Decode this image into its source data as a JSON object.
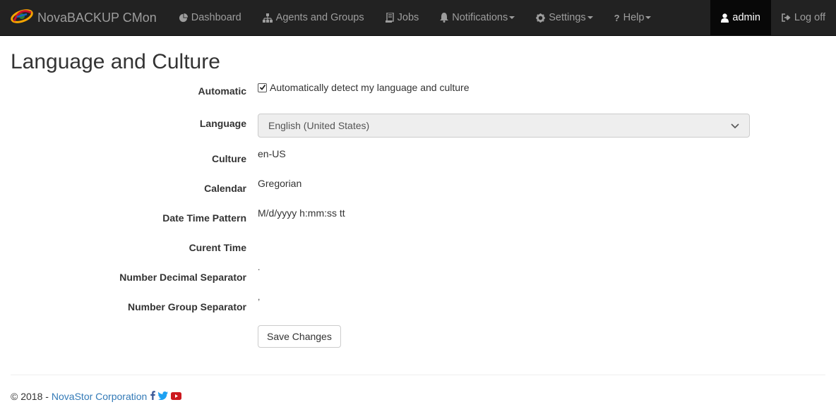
{
  "navbar": {
    "brand": "NovaBACKUP CMon",
    "items": [
      {
        "label": "Dashboard",
        "icon": "pie-chart-icon"
      },
      {
        "label": "Agents and Groups",
        "icon": "sitemap-icon"
      },
      {
        "label": "Jobs",
        "icon": "jobs-icon"
      },
      {
        "label": "Notifications",
        "icon": "bell-icon"
      },
      {
        "label": "Settings",
        "icon": "gear-icon"
      },
      {
        "label": "Help",
        "icon": "question-icon"
      }
    ],
    "user": "admin",
    "logoff": "Log off"
  },
  "page": {
    "title": "Language and Culture",
    "fields": {
      "automatic_label": "Automatic",
      "automatic_text": "Automatically detect my language and culture",
      "automatic_checked": true,
      "language_label": "Language",
      "language_value": "English (United States)",
      "culture_label": "Culture",
      "culture_value": "en-US",
      "calendar_label": "Calendar",
      "calendar_value": "Gregorian",
      "datetime_label": "Date Time Pattern",
      "datetime_value": "M/d/yyyy h:mm:ss tt",
      "current_time_label": "Curent Time",
      "current_time_value": "",
      "decimal_label": "Number Decimal Separator",
      "decimal_value": ".",
      "group_label": "Number Group Separator",
      "group_value": ","
    },
    "save_label": "Save Changes"
  },
  "footer": {
    "copyright": "© 2018 -",
    "company": "NovaStor Corporation"
  },
  "colors": {
    "navbar_bg": "#222222",
    "link": "#337ab7",
    "facebook": "#3b5998",
    "twitter": "#1da1f2",
    "youtube": "#cc181e"
  }
}
